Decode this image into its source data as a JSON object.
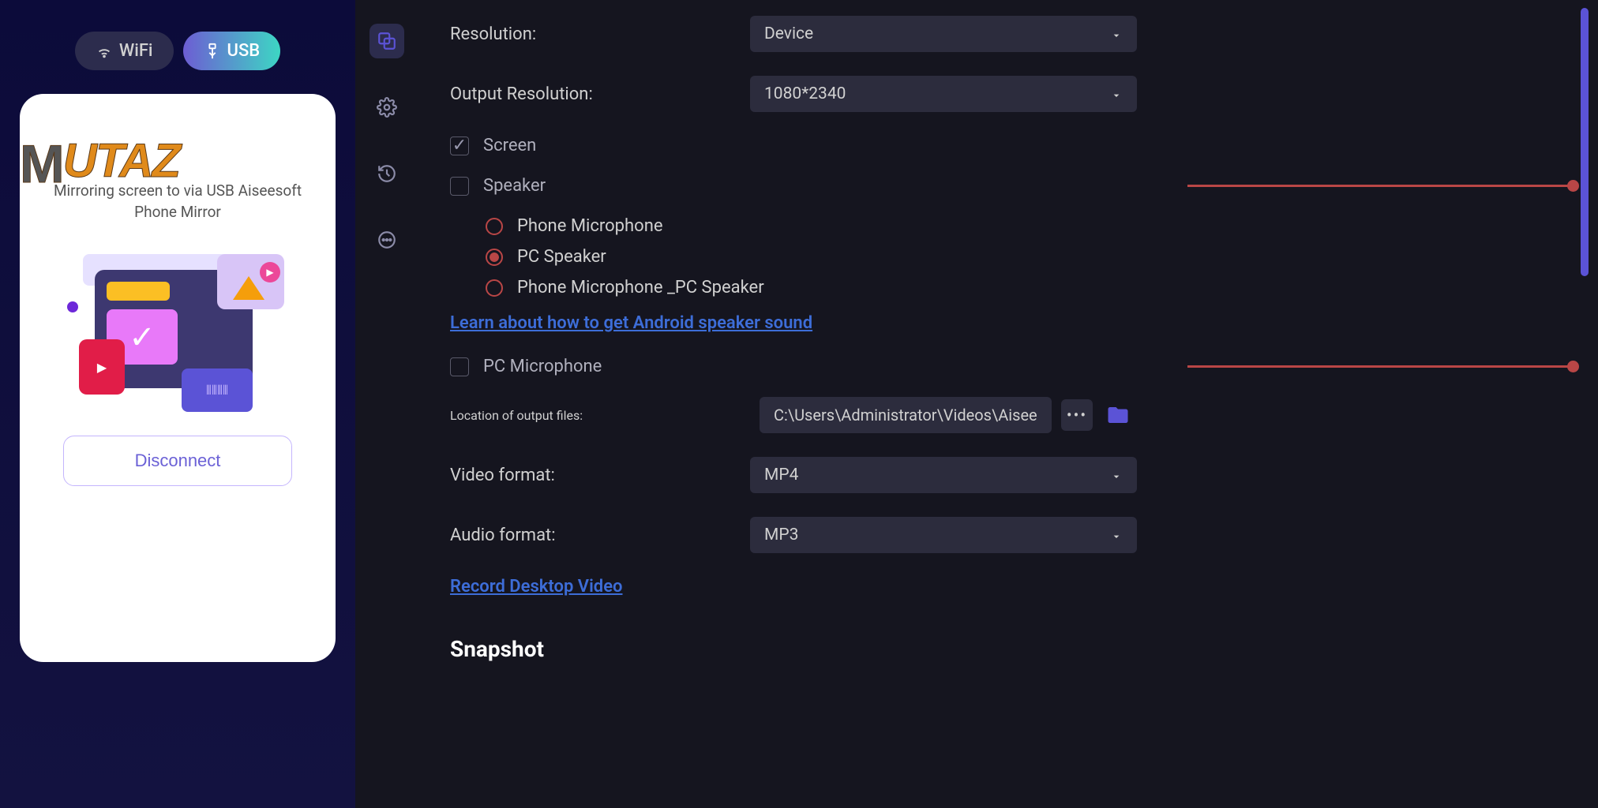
{
  "conn": {
    "wifi": "WiFi",
    "usb": "USB"
  },
  "watermark": "UTAZ",
  "mirror_message": "Mirroring screen to via USB Aiseesoft Phone Mirror",
  "disconnect": "Disconnect",
  "settings": {
    "resolution_label": "Resolution:",
    "resolution_value": "Device",
    "output_res_label": "Output Resolution:",
    "output_res_value": "1080*2340",
    "screen_label": "Screen",
    "speaker_label": "Speaker",
    "radio_phone_mic": "Phone Microphone",
    "radio_pc_speaker": "PC Speaker",
    "radio_both": "Phone Microphone _PC Speaker",
    "learn_link": "Learn about how to get Android speaker sound",
    "pc_mic_label": "PC Microphone",
    "output_loc_label": "Location of output files:",
    "output_loc_value": "C:\\Users\\Administrator\\Videos\\Aisee",
    "video_fmt_label": "Video format:",
    "video_fmt_value": "MP4",
    "audio_fmt_label": "Audio format:",
    "audio_fmt_value": "MP3",
    "record_link": "Record Desktop Video",
    "snapshot_title": "Snapshot"
  }
}
